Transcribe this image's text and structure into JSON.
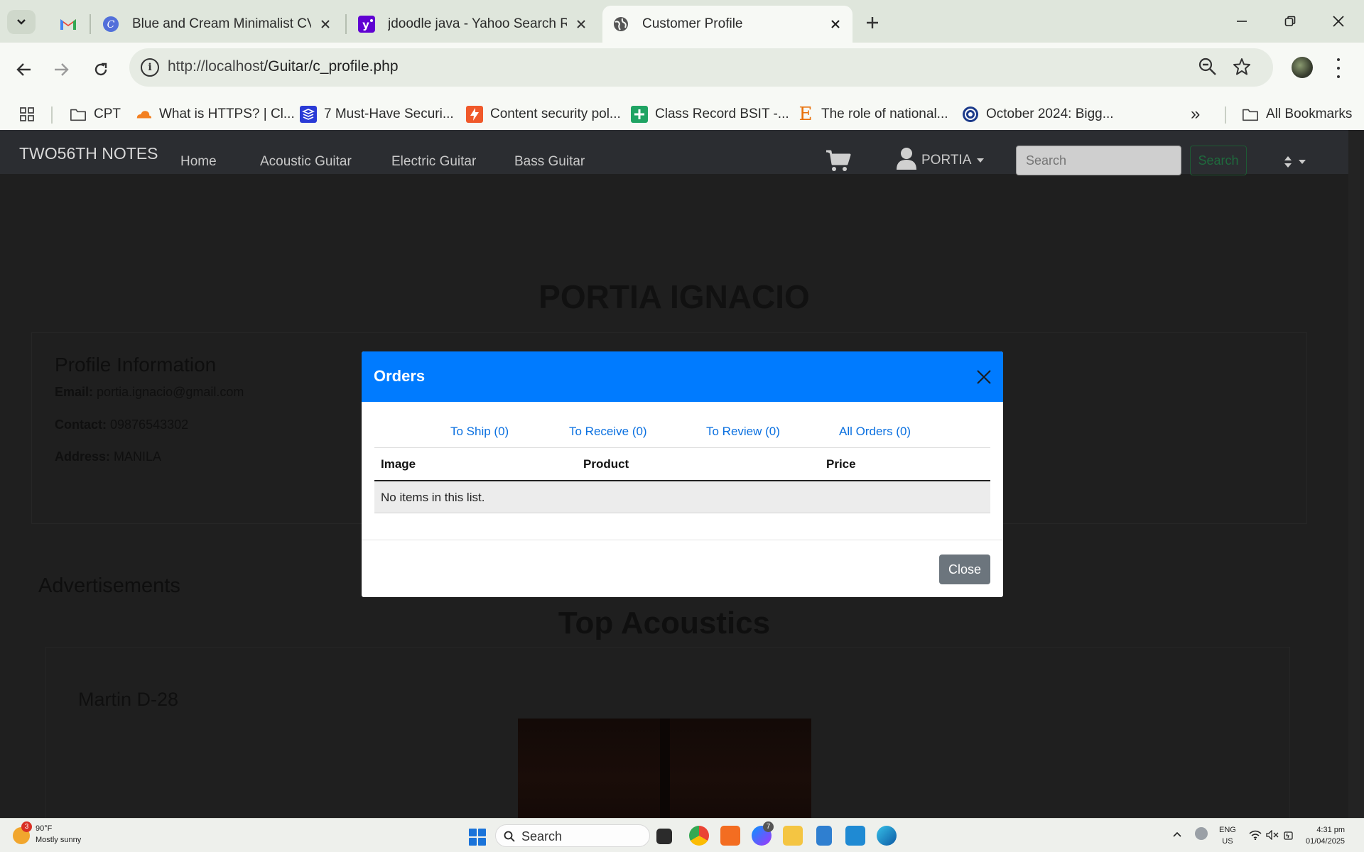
{
  "browser": {
    "tabs": [
      {
        "title": "Blue and Cream Minimalist CV Resume",
        "icon": "canva-icon"
      },
      {
        "title": "jdoodle java - Yahoo Search Results",
        "icon": "yahoo-icon"
      },
      {
        "title": "Customer Profile",
        "icon": "globe-icon",
        "active": true
      }
    ],
    "url_host": "http://localhost",
    "url_path": "/Guitar/c_profile.php",
    "bookmarks": [
      {
        "label": "CPT",
        "icon": "folder-icon"
      },
      {
        "label": "What is HTTPS? | Cl...",
        "icon": "cloudflare-icon"
      },
      {
        "label": "7 Must-Have Securi...",
        "icon": "layers-icon"
      },
      {
        "label": "Content security pol...",
        "icon": "bolt-icon"
      },
      {
        "label": "Class Record BSIT -...",
        "icon": "sheets-icon"
      },
      {
        "label": "The role of national...",
        "icon": "e-letter-icon"
      },
      {
        "label": "October 2024: Bigg...",
        "icon": "eye-icon"
      }
    ],
    "all_bookmarks": "All Bookmarks",
    "chevron": "»"
  },
  "site": {
    "brand": "TWO56TH NOTES",
    "nav": [
      "Home",
      "Acoustic Guitar",
      "Electric Guitar",
      "Bass Guitar"
    ],
    "user": "PORTIA",
    "search_placeholder": "Search",
    "search_button": "Search"
  },
  "profile": {
    "name": "PORTIA IGNACIO",
    "heading": "Profile Information",
    "email_label": "Email:",
    "email": "portia.ignacio@gmail.com",
    "contact_label": "Contact:",
    "contact": "09876543302",
    "address_label": "Address:",
    "address": "MANILA"
  },
  "ads": {
    "heading": "Advertisements",
    "section_title": "Top Acoustics",
    "product": "Martin D-28"
  },
  "modal": {
    "title": "Orders",
    "tabs": [
      "To Ship (0)",
      "To Receive (0)",
      "To Review (0)",
      "All Orders (0)"
    ],
    "columns": [
      "Image",
      "Product",
      "Price"
    ],
    "empty_text": "No items in this list.",
    "close_button": "Close"
  },
  "taskbar": {
    "weather_temp": "90°F",
    "weather_desc": "Mostly sunny",
    "weather_badge": "3",
    "search": "Search",
    "messenger_badge": "7",
    "lang_1": "ENG",
    "lang_2": "US",
    "time": "4:31 pm",
    "date": "01/04/2025"
  },
  "colors": {
    "modal_header": "#007bff",
    "close_button": "#6c757d",
    "link": "#0a70e0"
  }
}
